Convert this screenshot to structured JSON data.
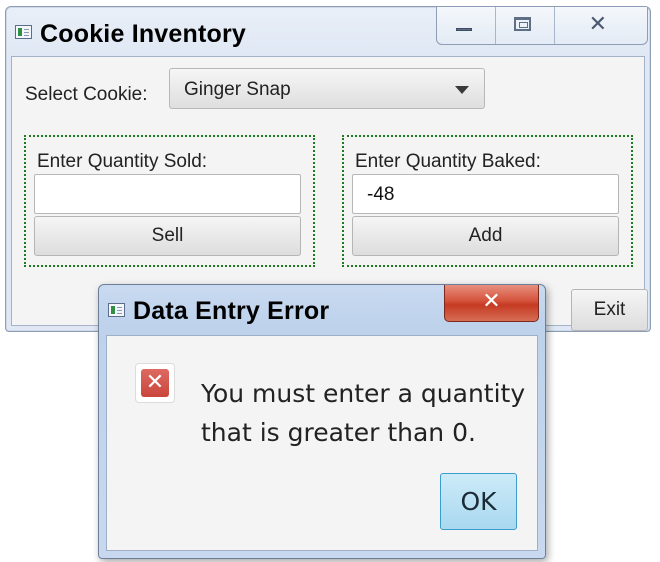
{
  "main_window": {
    "title": "Cookie Inventory",
    "select_label": "Select Cookie:",
    "selected_cookie": "Ginger Snap",
    "sold_group": {
      "label": "Enter Quantity Sold:",
      "value": "",
      "button_label": "Sell"
    },
    "baked_group": {
      "label": "Enter Quantity Baked:",
      "value": "-48",
      "button_label": "Add"
    },
    "exit_label": "Exit",
    "window_buttons": {
      "minimize_icon": "minimize-icon",
      "maximize_icon": "maximize-icon",
      "close_glyph": "✕"
    },
    "group_border_color": "#1e7a1e"
  },
  "dialog": {
    "title": "Data Entry Error",
    "close_glyph": "✕",
    "icon": "error-icon",
    "icon_glyph": "✕",
    "message_line1": "You must enter a quantity",
    "message_line2": "that is greater than 0.",
    "ok_label": "OK",
    "close_color": "#c53a22",
    "ok_color": "#a9d8ef"
  }
}
